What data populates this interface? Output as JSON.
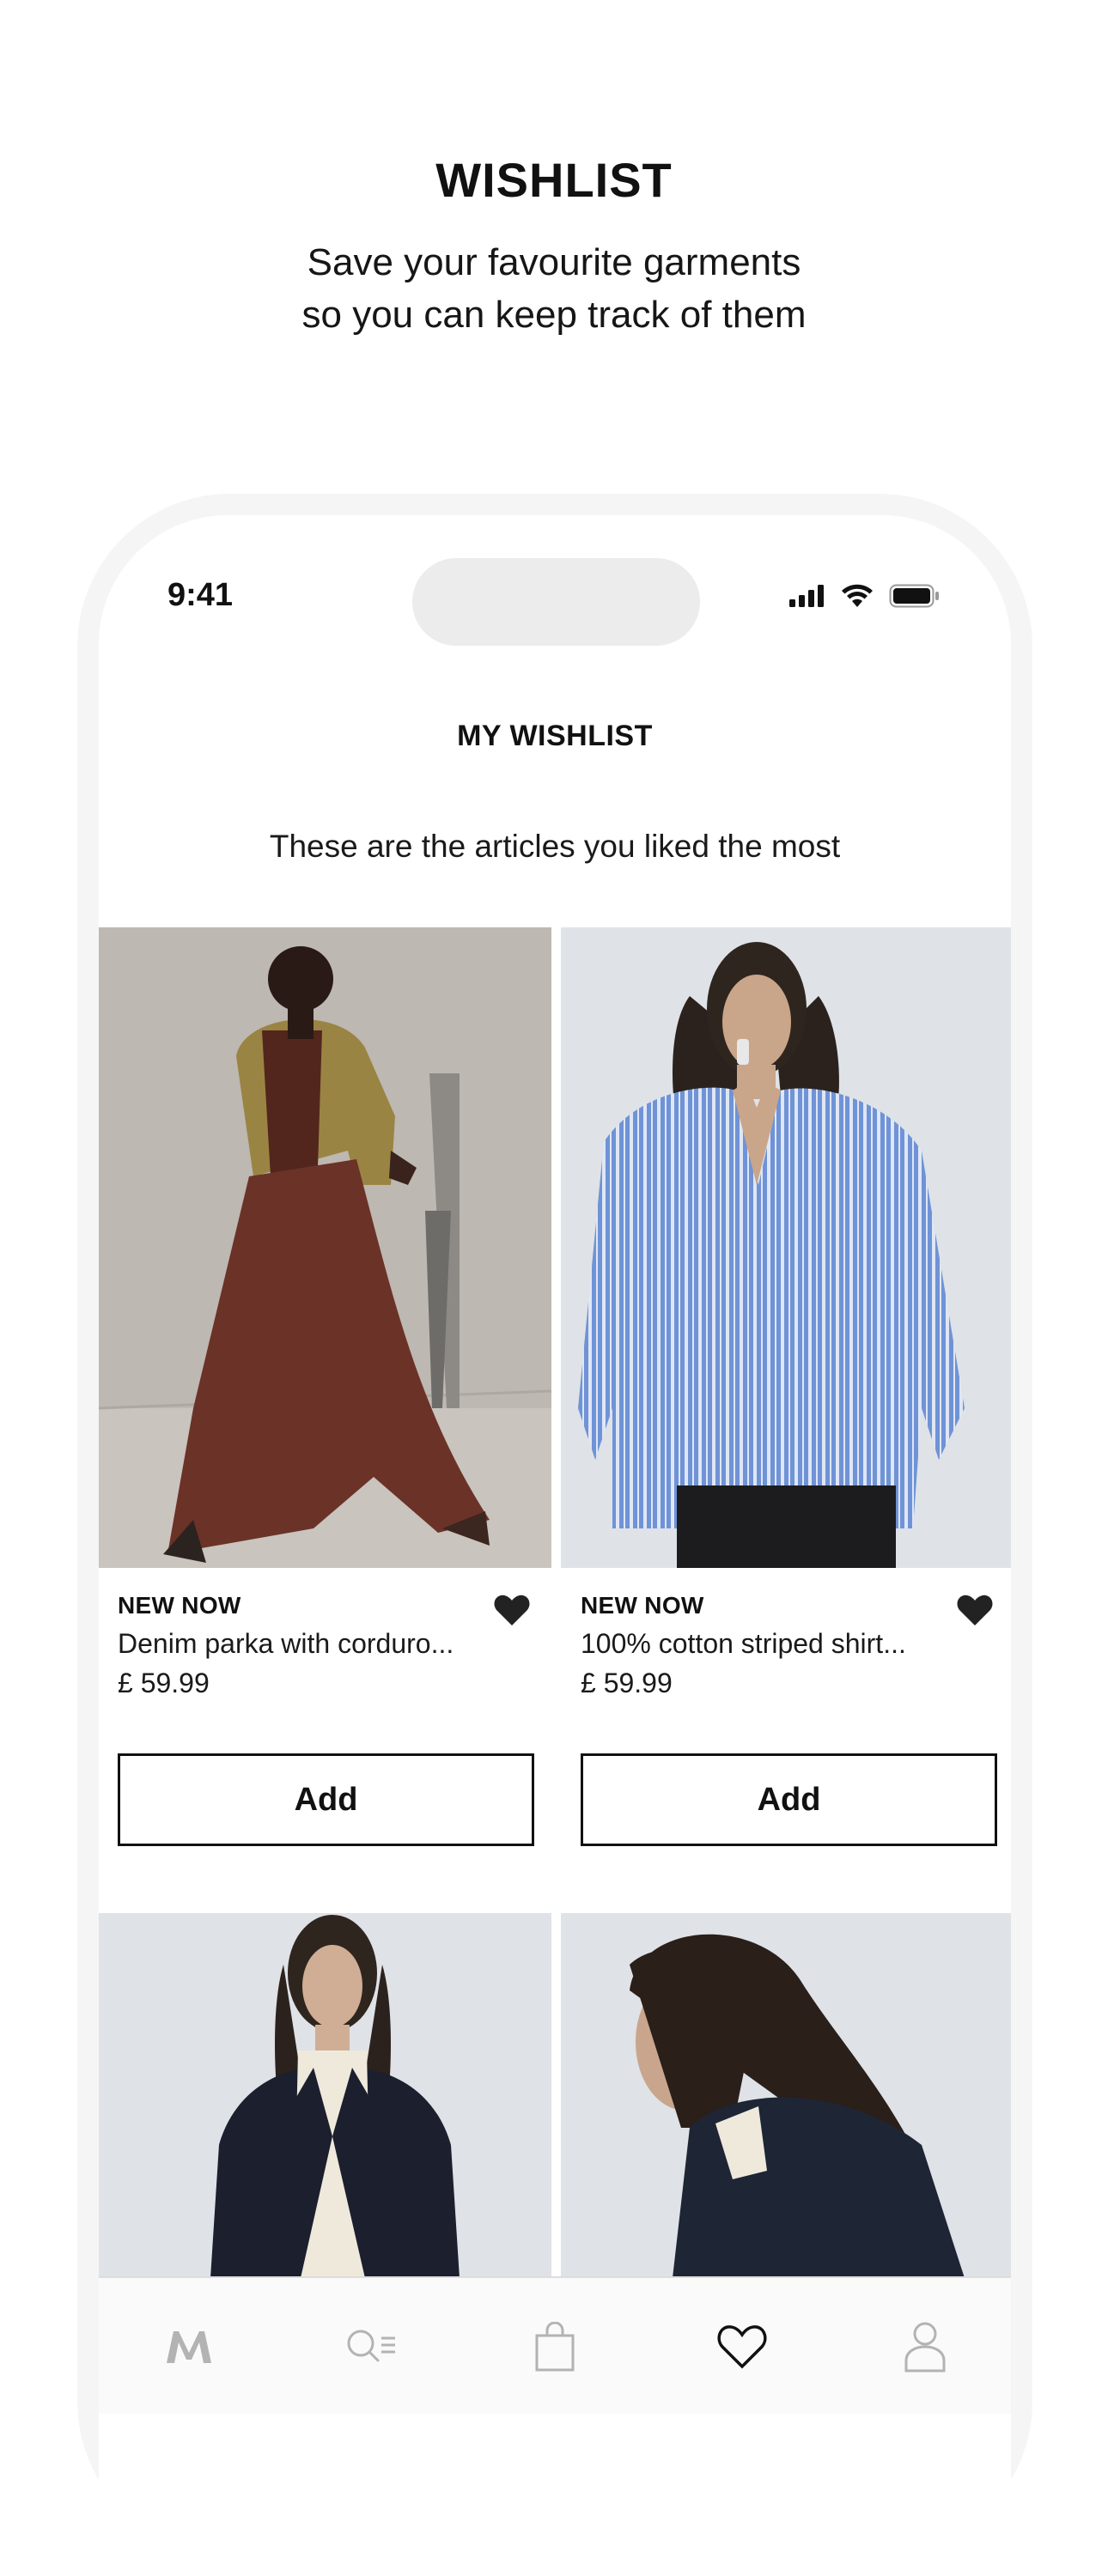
{
  "promo": {
    "title": "WISHLIST",
    "subtitle_line1": "Save your favourite garments",
    "subtitle_line2": "so you can keep track of them"
  },
  "status_bar": {
    "time": "9:41"
  },
  "screen": {
    "title": "MY WISHLIST",
    "subtitle": "These are the articles you liked the most"
  },
  "products": [
    {
      "badge": "NEW NOW",
      "name": "Denim parka with corduro...",
      "price": "£ 59.99",
      "add_label": "Add",
      "favourited": true
    },
    {
      "badge": "NEW NOW",
      "name": "100% cotton striped shirt...",
      "price": "£ 59.99",
      "add_label": "Add",
      "favourited": true
    }
  ],
  "tab_bar": {
    "items": [
      {
        "icon": "brand-logo-icon",
        "active": false
      },
      {
        "icon": "search-menu-icon",
        "active": false
      },
      {
        "icon": "shopping-bag-icon",
        "active": false
      },
      {
        "icon": "heart-icon",
        "active": true
      },
      {
        "icon": "profile-icon",
        "active": false
      }
    ]
  },
  "colors": {
    "accent": "#111111",
    "frame": "#f5f5f5",
    "tab_inactive": "#b3b3b3",
    "product_bg_1": "#bdb8b1",
    "product_bg_2": "#dfe2e6"
  }
}
